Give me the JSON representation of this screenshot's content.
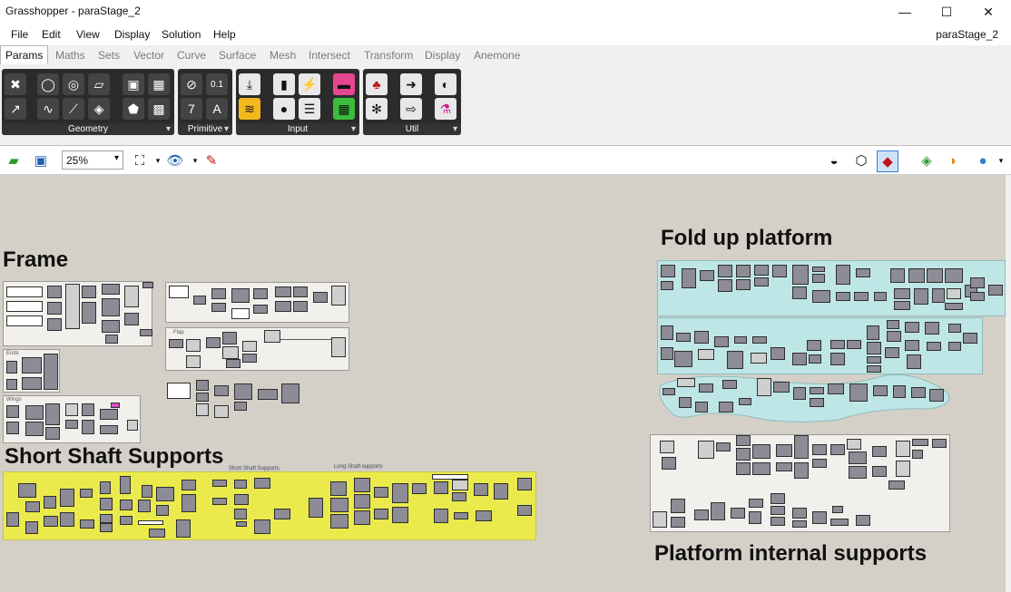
{
  "window": {
    "title": "Grasshopper - paraStage_2",
    "minimize": "—",
    "maximize": "☐",
    "close": "✕"
  },
  "menubar": {
    "items": [
      "File",
      "Edit",
      "View",
      "Display",
      "Solution",
      "Help"
    ],
    "document_name": "paraStage_2"
  },
  "tabs": [
    "Params",
    "Maths",
    "Sets",
    "Vector",
    "Curve",
    "Surface",
    "Mesh",
    "Intersect",
    "Transform",
    "Display",
    "Anemone"
  ],
  "active_tab": "Params",
  "ribbon": {
    "panels": [
      "Geometry",
      "Primitive",
      "Input",
      "Util"
    ]
  },
  "toolbar": {
    "zoom": "25%"
  },
  "canvas": {
    "headings": {
      "frame": "Frame",
      "short_shaft": "Short Shaft Supports",
      "fold_up": "Fold up platform",
      "platform_internal": "Platform internal supports"
    },
    "group_labels": {
      "ends": "Ends",
      "wings": "Wings",
      "flap": "Flap",
      "short_shaft_small": "Short Shaft Supports",
      "long_shaft_small": "Long Shaft supports"
    }
  },
  "colors": {
    "yellow_group": "#eaea4c",
    "cyan_group": "#bfe6e6",
    "canvas": "#d4d0c8"
  }
}
